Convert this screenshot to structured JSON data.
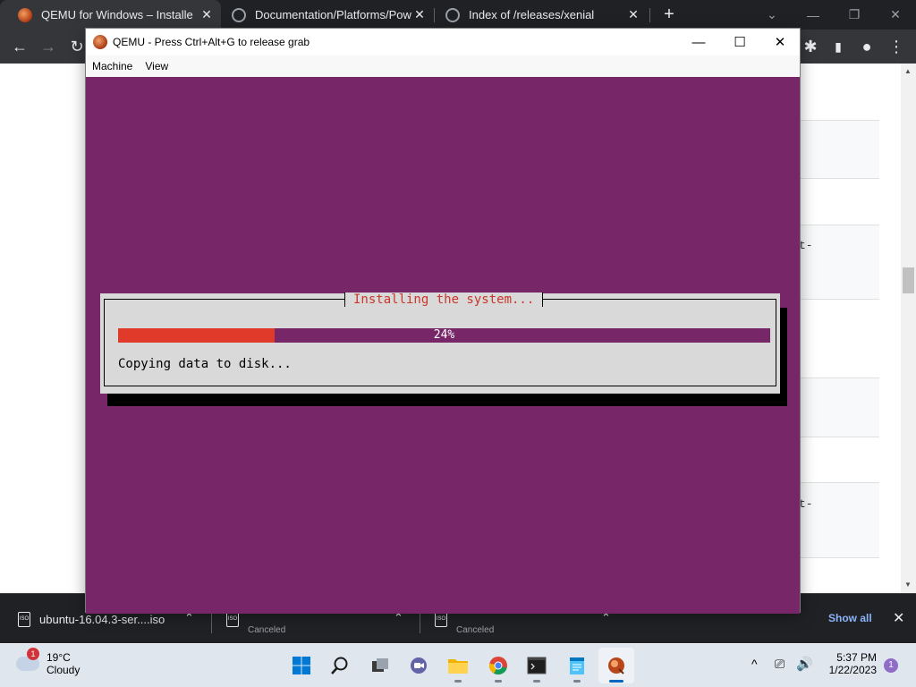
{
  "browser": {
    "tabs": [
      {
        "title": "QEMU for Windows – Installers (",
        "close": "✕",
        "favicon": "qemu-icon",
        "active": true
      },
      {
        "title": "Documentation/Platforms/Powe",
        "close": "✕",
        "favicon": "globe-icon",
        "active": false
      },
      {
        "title": "Index of /releases/xenial",
        "close": "✕",
        "favicon": "globe-icon",
        "active": false
      }
    ],
    "new_tab": "+",
    "window_controls": {
      "tab_search": "⌄",
      "minimize": "—",
      "restore": "❐",
      "close": "✕"
    },
    "toolbar": {
      "back": "←",
      "forward": "→",
      "reload": "↻",
      "extensions": "✱",
      "side_panel": "▮",
      "profile": "●",
      "menu": "⋮"
    },
    "page_fragments": [
      "t-",
      "t-"
    ],
    "scroll_up": "▲",
    "scroll_down": "▼"
  },
  "downloads": {
    "items": [
      {
        "name": "ubuntu-16.04.3-ser....iso",
        "status": "",
        "icon": "ISO"
      },
      {
        "name": "",
        "status": "Canceled",
        "icon": "ISO"
      },
      {
        "name": "",
        "status": "Canceled",
        "icon": "ISO"
      }
    ],
    "chevron": "⌃",
    "show_all": "Show all",
    "close": "✕"
  },
  "qemu": {
    "title": "QEMU - Press Ctrl+Alt+G to release grab",
    "controls": {
      "minimize": "—",
      "maximize": "☐",
      "close": "✕"
    },
    "menu": [
      "Machine",
      "View"
    ],
    "dialog": {
      "title": "Installing the system...",
      "progress_percent": 24,
      "progress_label": "24%",
      "message": "Copying data to disk..."
    }
  },
  "taskbar": {
    "weather": {
      "temp": "19°C",
      "condition": "Cloudy",
      "badge": "1"
    },
    "apps": [
      "windows-start-icon",
      "search-icon",
      "task-view-icon",
      "teams-chat-icon",
      "file-explorer-icon",
      "chrome-icon",
      "terminal-icon",
      "notepad-icon",
      "qemu-icon"
    ],
    "tray": {
      "chevron": "^",
      "network": "⎚",
      "volume": "🔊"
    },
    "clock": {
      "time": "5:37 PM",
      "date": "1/22/2023"
    },
    "notifications": "1"
  },
  "colors": {
    "vm_background": "#772668",
    "progress_fill": "#e03a2b",
    "dialog_title": "#c7372a",
    "dialog_bg": "#d9d9d9"
  }
}
